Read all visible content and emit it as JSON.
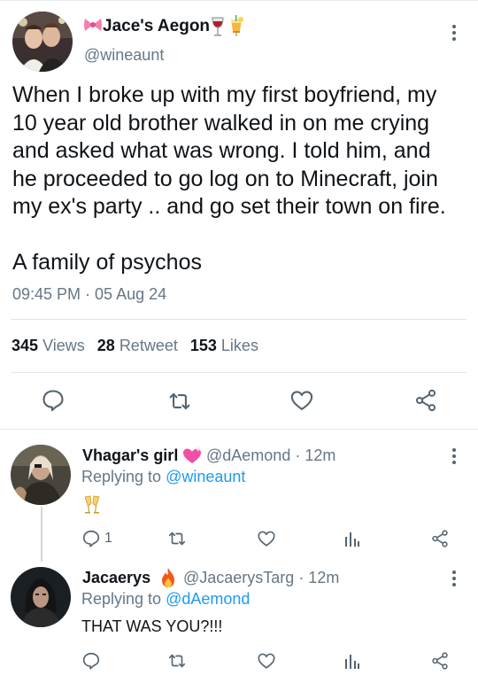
{
  "main_tweet": {
    "display_name": "Jace's Aegon",
    "handle": "@wineaunt",
    "text_paragraphs": [
      "When I broke up with my first boyfriend, my\n10 year old brother walked in on me crying\nand asked what was wrong. I told him, and\nhe proceeded to go log on to Minecraft, join\nmy ex's party .. and go set their town on fire.",
      "A family of psychos"
    ],
    "timestamp": "09:45 PM · 05 Aug 24",
    "views_count": "345",
    "views_label": "Views",
    "retweets_count": "28",
    "retweets_label": "Retweet",
    "likes_count": "153",
    "likes_label": "Likes"
  },
  "replies": [
    {
      "display_name": "Vhagar's girl",
      "meta": "@dAemond · 12m",
      "replying_prefix": "Replying to",
      "replying_to": "@wineaunt",
      "reply_count": "1"
    },
    {
      "display_name": "Jacaerys",
      "meta": "@JacaerysTarg · 12m",
      "replying_prefix": "Replying to",
      "replying_to": "@dAemond",
      "text": "THAT WAS YOU?!!!"
    }
  ],
  "colors": {
    "link": "#1d9bf0",
    "secondary_text": "#657786",
    "primary_text": "#0f1419",
    "icon": "#536471"
  }
}
